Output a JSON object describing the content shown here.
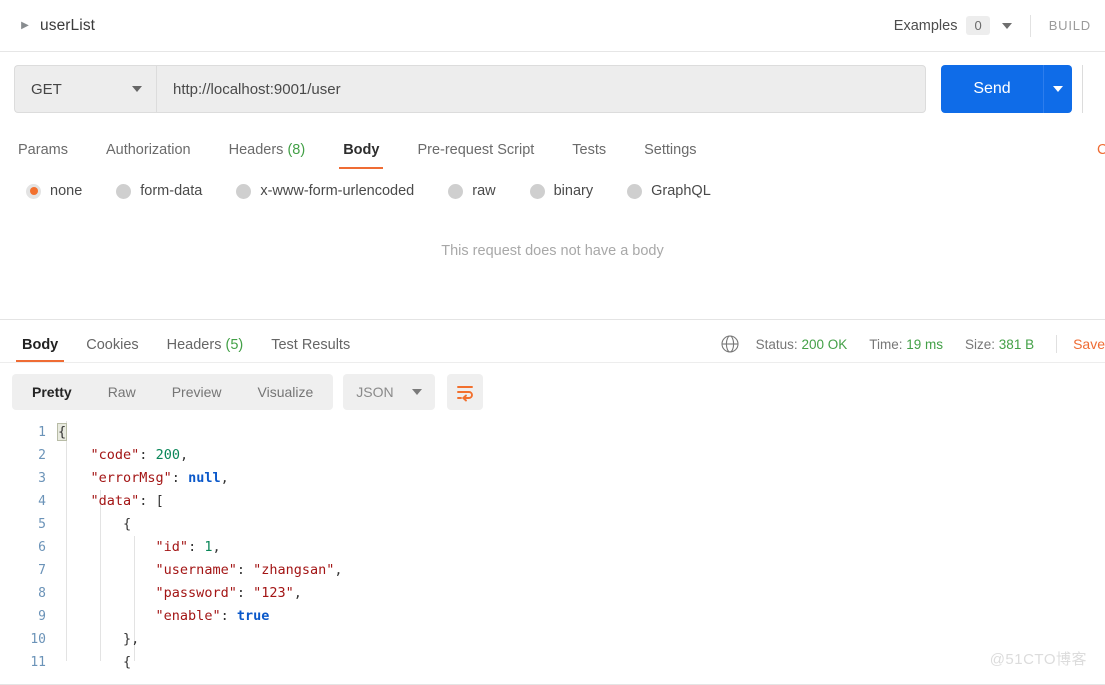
{
  "header": {
    "request_name": "userList",
    "caret_icon": "triangle-right-icon",
    "examples_label": "Examples",
    "examples_count": "0",
    "build_label": "BUILD"
  },
  "url_bar": {
    "method": "GET",
    "url": "http://localhost:9001/user",
    "send_label": "Send"
  },
  "request_tabs": {
    "items": [
      {
        "label": "Params",
        "count": "",
        "active": false
      },
      {
        "label": "Authorization",
        "count": "",
        "active": false
      },
      {
        "label": "Headers",
        "count": "(8)",
        "active": false
      },
      {
        "label": "Body",
        "count": "",
        "active": true
      },
      {
        "label": "Pre-request Script",
        "count": "",
        "active": false
      },
      {
        "label": "Tests",
        "count": "",
        "active": false
      },
      {
        "label": "Settings",
        "count": "",
        "active": false
      }
    ],
    "cookies_link": "Cookies"
  },
  "body_types": {
    "options": [
      {
        "label": "none",
        "selected": true
      },
      {
        "label": "form-data",
        "selected": false
      },
      {
        "label": "x-www-form-urlencoded",
        "selected": false
      },
      {
        "label": "raw",
        "selected": false
      },
      {
        "label": "binary",
        "selected": false
      },
      {
        "label": "GraphQL",
        "selected": false
      }
    ],
    "empty_message": "This request does not have a body"
  },
  "response": {
    "tabs": [
      {
        "label": "Body",
        "count": "",
        "active": true
      },
      {
        "label": "Cookies",
        "count": "",
        "active": false
      },
      {
        "label": "Headers",
        "count": "(5)",
        "active": false
      },
      {
        "label": "Test Results",
        "count": "",
        "active": false
      }
    ],
    "globe_icon": "globe-icon",
    "status_label": "Status:",
    "status_value": "200 OK",
    "time_label": "Time:",
    "time_value": "19 ms",
    "size_label": "Size:",
    "size_value": "381 B",
    "save_label": "Save",
    "viewer": {
      "modes": [
        {
          "label": "Pretty",
          "active": true
        },
        {
          "label": "Raw",
          "active": false
        },
        {
          "label": "Preview",
          "active": false
        },
        {
          "label": "Visualize",
          "active": false
        }
      ],
      "format": "JSON",
      "wrap_icon": "wrap-lines-icon"
    },
    "code_lines": [
      {
        "num": "1",
        "tokens": [
          {
            "t": "{",
            "c": "p hl"
          }
        ]
      },
      {
        "num": "2",
        "tokens": [
          {
            "t": "    ",
            "c": "p"
          },
          {
            "t": "\"code\"",
            "c": "k"
          },
          {
            "t": ": ",
            "c": "p"
          },
          {
            "t": "200",
            "c": "n"
          },
          {
            "t": ",",
            "c": "p"
          }
        ]
      },
      {
        "num": "3",
        "tokens": [
          {
            "t": "    ",
            "c": "p"
          },
          {
            "t": "\"errorMsg\"",
            "c": "k"
          },
          {
            "t": ": ",
            "c": "p"
          },
          {
            "t": "null",
            "c": "b"
          },
          {
            "t": ",",
            "c": "p"
          }
        ]
      },
      {
        "num": "4",
        "tokens": [
          {
            "t": "    ",
            "c": "p"
          },
          {
            "t": "\"data\"",
            "c": "k"
          },
          {
            "t": ": ",
            "c": "p"
          },
          {
            "t": "[",
            "c": "p"
          }
        ]
      },
      {
        "num": "5",
        "tokens": [
          {
            "t": "        ",
            "c": "p"
          },
          {
            "t": "{",
            "c": "p"
          }
        ]
      },
      {
        "num": "6",
        "tokens": [
          {
            "t": "            ",
            "c": "p"
          },
          {
            "t": "\"id\"",
            "c": "k"
          },
          {
            "t": ": ",
            "c": "p"
          },
          {
            "t": "1",
            "c": "n"
          },
          {
            "t": ",",
            "c": "p"
          }
        ]
      },
      {
        "num": "7",
        "tokens": [
          {
            "t": "            ",
            "c": "p"
          },
          {
            "t": "\"username\"",
            "c": "k"
          },
          {
            "t": ": ",
            "c": "p"
          },
          {
            "t": "\"zhangsan\"",
            "c": "s"
          },
          {
            "t": ",",
            "c": "p"
          }
        ]
      },
      {
        "num": "8",
        "tokens": [
          {
            "t": "            ",
            "c": "p"
          },
          {
            "t": "\"password\"",
            "c": "k"
          },
          {
            "t": ": ",
            "c": "p"
          },
          {
            "t": "\"123\"",
            "c": "s"
          },
          {
            "t": ",",
            "c": "p"
          }
        ]
      },
      {
        "num": "9",
        "tokens": [
          {
            "t": "            ",
            "c": "p"
          },
          {
            "t": "\"enable\"",
            "c": "k"
          },
          {
            "t": ": ",
            "c": "p"
          },
          {
            "t": "true",
            "c": "b"
          }
        ]
      },
      {
        "num": "10",
        "tokens": [
          {
            "t": "        ",
            "c": "p"
          },
          {
            "t": "},",
            "c": "p"
          }
        ]
      },
      {
        "num": "11",
        "tokens": [
          {
            "t": "        ",
            "c": "p"
          },
          {
            "t": "{",
            "c": "p"
          }
        ]
      }
    ]
  },
  "watermark": "@51CTO博客"
}
